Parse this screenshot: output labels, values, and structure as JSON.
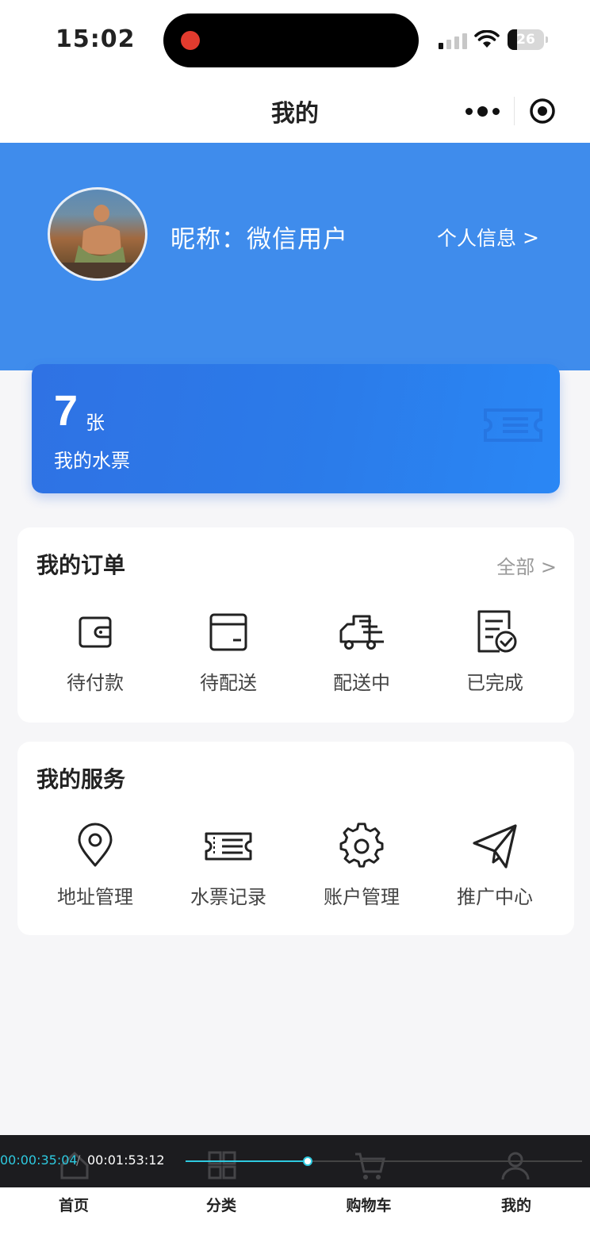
{
  "status_bar": {
    "time": "15:02",
    "battery": "26"
  },
  "nav": {
    "title": "我的"
  },
  "profile": {
    "nickname": "昵称：微信用户",
    "info_link": "个人信息",
    "info_chevron": ">"
  },
  "ticket": {
    "count": "7",
    "unit": "张",
    "label": "我的水票"
  },
  "orders": {
    "title": "我的订单",
    "all_link": "全部 >",
    "items": [
      {
        "label": "待付款",
        "icon": "wallet-icon"
      },
      {
        "label": "待配送",
        "icon": "box-icon"
      },
      {
        "label": "配送中",
        "icon": "delivery-truck-icon"
      },
      {
        "label": "已完成",
        "icon": "completed-document-icon"
      }
    ]
  },
  "services": {
    "title": "我的服务",
    "items": [
      {
        "label": "地址管理",
        "icon": "location-pin-icon"
      },
      {
        "label": "水票记录",
        "icon": "ticket-icon"
      },
      {
        "label": "账户管理",
        "icon": "gear-icon"
      },
      {
        "label": "推广中心",
        "icon": "paper-plane-icon"
      }
    ]
  },
  "video_bar": {
    "current": "00:00:35:04",
    "separator": "/",
    "total": "00:01:53:12",
    "progress": 0.308
  },
  "tabbar": {
    "items": [
      {
        "label": "首页",
        "icon": "home-icon"
      },
      {
        "label": "分类",
        "icon": "grid-icon"
      },
      {
        "label": "购物车",
        "icon": "cart-icon"
      },
      {
        "label": "我的",
        "icon": "user-icon"
      }
    ]
  },
  "colors": {
    "primary_blue": "#3f8cec",
    "card_blue": "#2b7be9",
    "progress_teal": "#2ecae0"
  }
}
